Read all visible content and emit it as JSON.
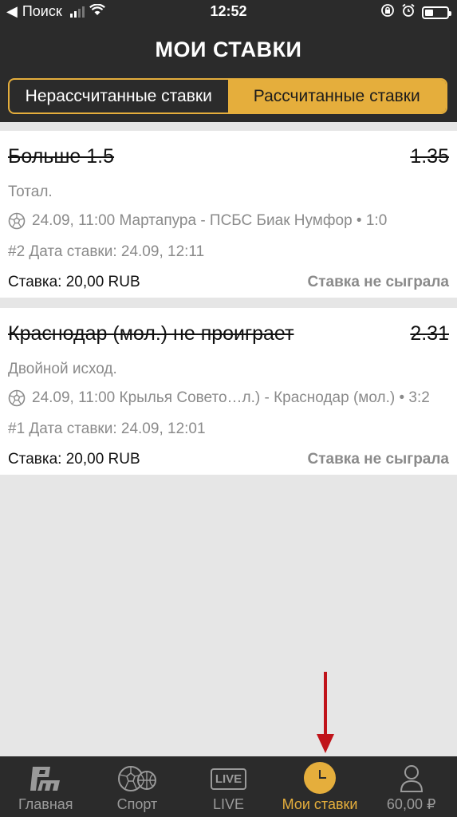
{
  "status_bar": {
    "carrier": "Поиск",
    "time": "12:52"
  },
  "header": {
    "title": "МОИ СТАВКИ"
  },
  "tabs": [
    {
      "label": "Нерассчитанные ставки",
      "active": false
    },
    {
      "label": "Рассчитанные ставки",
      "active": true
    }
  ],
  "bets": [
    {
      "title": "Больше 1.5",
      "odds": "1.35",
      "market": "Тотал.",
      "event": "24.09, 11:00 Мартапура - ПСБС Биак Нумфор • 1:0",
      "bet_date": "#2 Дата ставки: 24.09, 12:11",
      "stake": "Ставка: 20,00 RUB",
      "result": "Ставка не сыграла"
    },
    {
      "title": "Краснодар (мол.) не проиграет",
      "odds": "2.31",
      "market": "Двойной исход.",
      "event": "24.09, 11:00 Крылья Совето…л.) - Краснодар (мол.) • 3:2",
      "bet_date": "#1 Дата ставки: 24.09, 12:01",
      "stake": "Ставка: 20,00 RUB",
      "result": "Ставка не сыграла"
    }
  ],
  "tabbar": {
    "items": [
      {
        "label": "Главная",
        "icon": "pm-logo-icon"
      },
      {
        "label": "Спорт",
        "icon": "ball-icon"
      },
      {
        "label": "LIVE",
        "icon": "live-icon",
        "icon_text": "LIVE"
      },
      {
        "label": "Мои ставки",
        "icon": "clock-icon",
        "active": true
      },
      {
        "label": "60,00 ₽",
        "icon": "user-icon"
      }
    ]
  },
  "colors": {
    "accent": "#e5ae3c",
    "dark": "#2b2b2b",
    "muted": "#8a8a8a",
    "arrow": "#c0141a"
  }
}
